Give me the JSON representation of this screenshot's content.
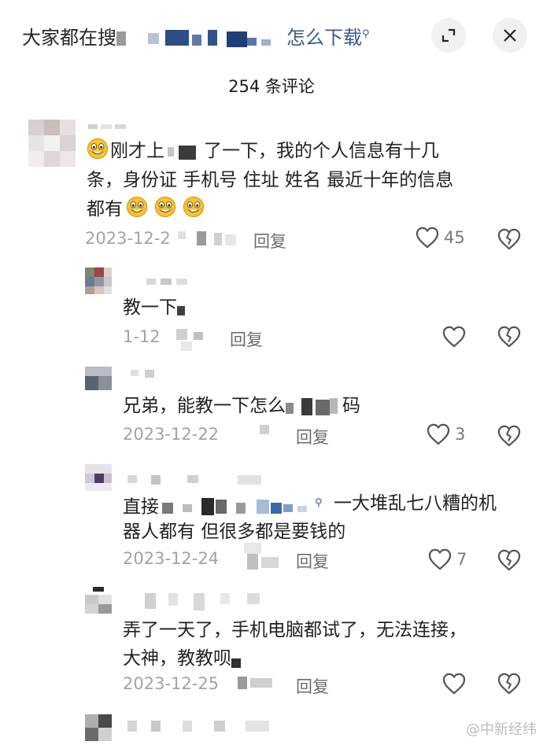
{
  "header": {
    "title_prefix": "大家都在搜",
    "title_link": "怎么下载",
    "comment_count": "254 条评论"
  },
  "comments": [
    {
      "line1": "刚才上",
      "line1b": "了一下，我的个人信息有十几",
      "line2": "条，身份证 手机号 住址 姓名 最近十年的信息",
      "line3": "都有",
      "date": "2023-12-2",
      "reply": "回复",
      "likes": "45"
    },
    {
      "text": "教一下",
      "date": "1-12",
      "reply": "回复"
    },
    {
      "text": "兄弟，能教一下怎么",
      "text_tail": "码",
      "date": "2023-12-22",
      "reply": "回复",
      "likes": "3"
    },
    {
      "text": "直接",
      "text_b": "一大堆乱七八糟的机",
      "line2": "器人都有 但很多都是要钱的",
      "date": "2023-12-24",
      "reply": "回复",
      "likes": "7"
    },
    {
      "line1": "弄了一天了，手机电脑都试了，无法连接，",
      "line2": "大神，教教呗",
      "date": "2023-12-25",
      "reply": "回复"
    }
  ],
  "watermark": "@中新经纬",
  "icons": [
    "expand-icon",
    "close-icon",
    "heart-icon",
    "broken-heart-icon",
    "grin-emoji-icon",
    "search-icon"
  ]
}
